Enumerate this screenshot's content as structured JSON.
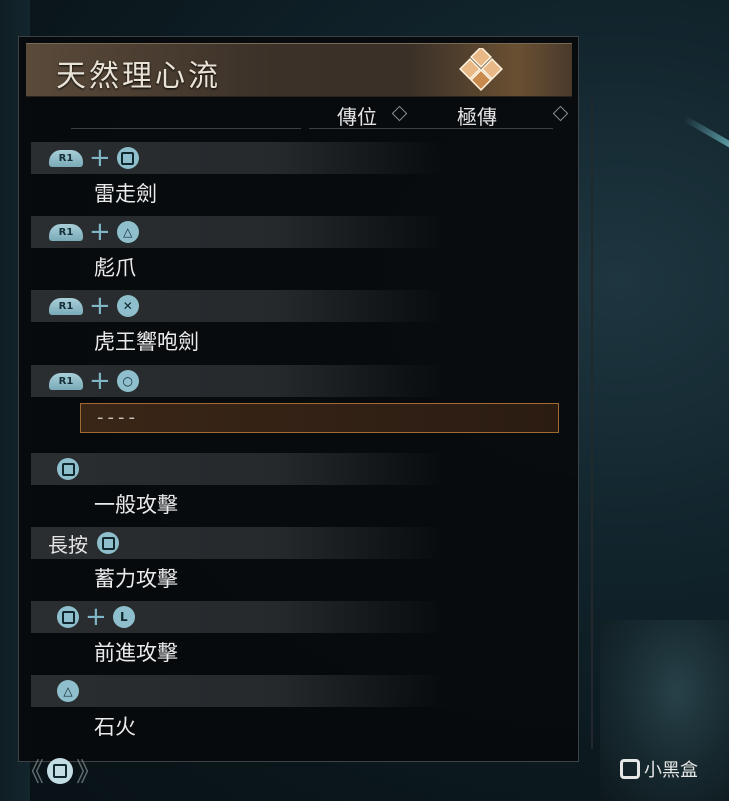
{
  "panel": {
    "title": "天然理心流"
  },
  "tabs": [
    {
      "label": "傳位"
    },
    {
      "label": "極傳"
    }
  ],
  "skills": [
    {
      "input": {
        "modifier": "R1",
        "plus": "+",
        "button": "□"
      },
      "name": "雷走劍"
    },
    {
      "input": {
        "modifier": "R1",
        "plus": "+",
        "button": "△"
      },
      "name": "彪爪"
    },
    {
      "input": {
        "modifier": "R1",
        "plus": "+",
        "button": "✕"
      },
      "name": "虎王響咆劍"
    },
    {
      "input": {
        "modifier": "R1",
        "plus": "+",
        "button": "○"
      },
      "name": "----"
    },
    {
      "input": {
        "button": "□"
      },
      "name": "一般攻擊"
    },
    {
      "input": {
        "prefix": "長按",
        "button": "□"
      },
      "name": "蓄力攻擊"
    },
    {
      "input": {
        "button": "□",
        "plus": "+",
        "stick": "L"
      },
      "name": "前進攻擊"
    },
    {
      "input": {
        "button": "△"
      },
      "name": "石火"
    }
  ],
  "pager": {
    "left": "《",
    "right": "》"
  },
  "watermark": {
    "text": "小黑盒"
  },
  "icons": {
    "emblem": "diamond-emblem-icon",
    "r1": "r1-button-icon",
    "square": "square-button-icon",
    "triangle": "triangle-button-icon",
    "cross": "cross-button-icon",
    "circle": "circle-button-icon",
    "stick": "left-stick-icon"
  },
  "colors": {
    "accent": "#8fbfcc",
    "selected_border": "#a06a33",
    "header_gold": "#6a5032"
  }
}
